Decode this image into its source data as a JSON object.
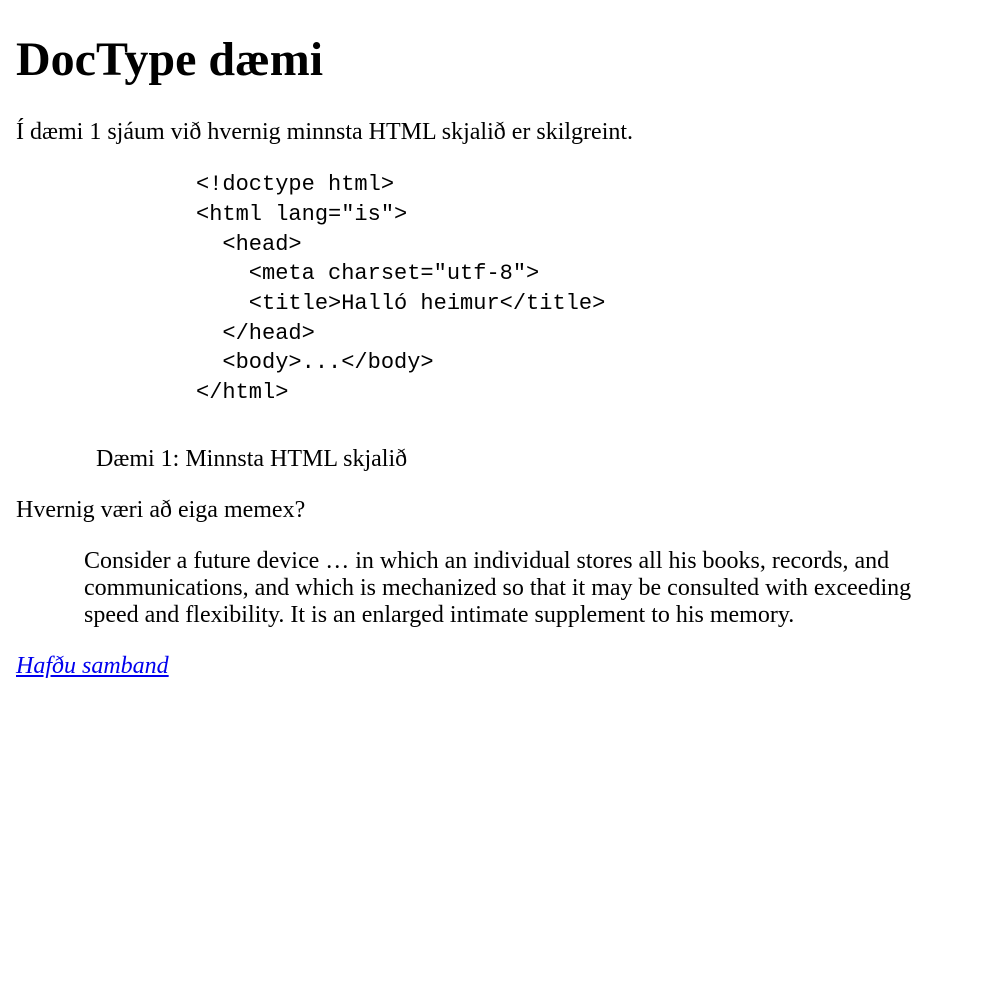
{
  "heading": "DocType dæmi",
  "intro": "Í dæmi 1 sjáum við hvernig minnsta HTML skjalið er skilgreint.",
  "code": "<!doctype html>\n<html lang=\"is\">\n  <head>\n    <meta charset=\"utf-8\">\n    <title>Halló heimur</title>\n  </head>\n  <body>...</body>\n</html>",
  "caption": "Dæmi 1: Minnsta HTML skjalið",
  "question": "Hvernig væri að eiga memex?",
  "quote": "Consider a future device … in which an individual stores all his books, records, and communications, and which is mechanized so that it may be consulted with exceeding speed and flexibility. It is an enlarged intimate supplement to his memory.",
  "contact_link": "Hafðu samband"
}
